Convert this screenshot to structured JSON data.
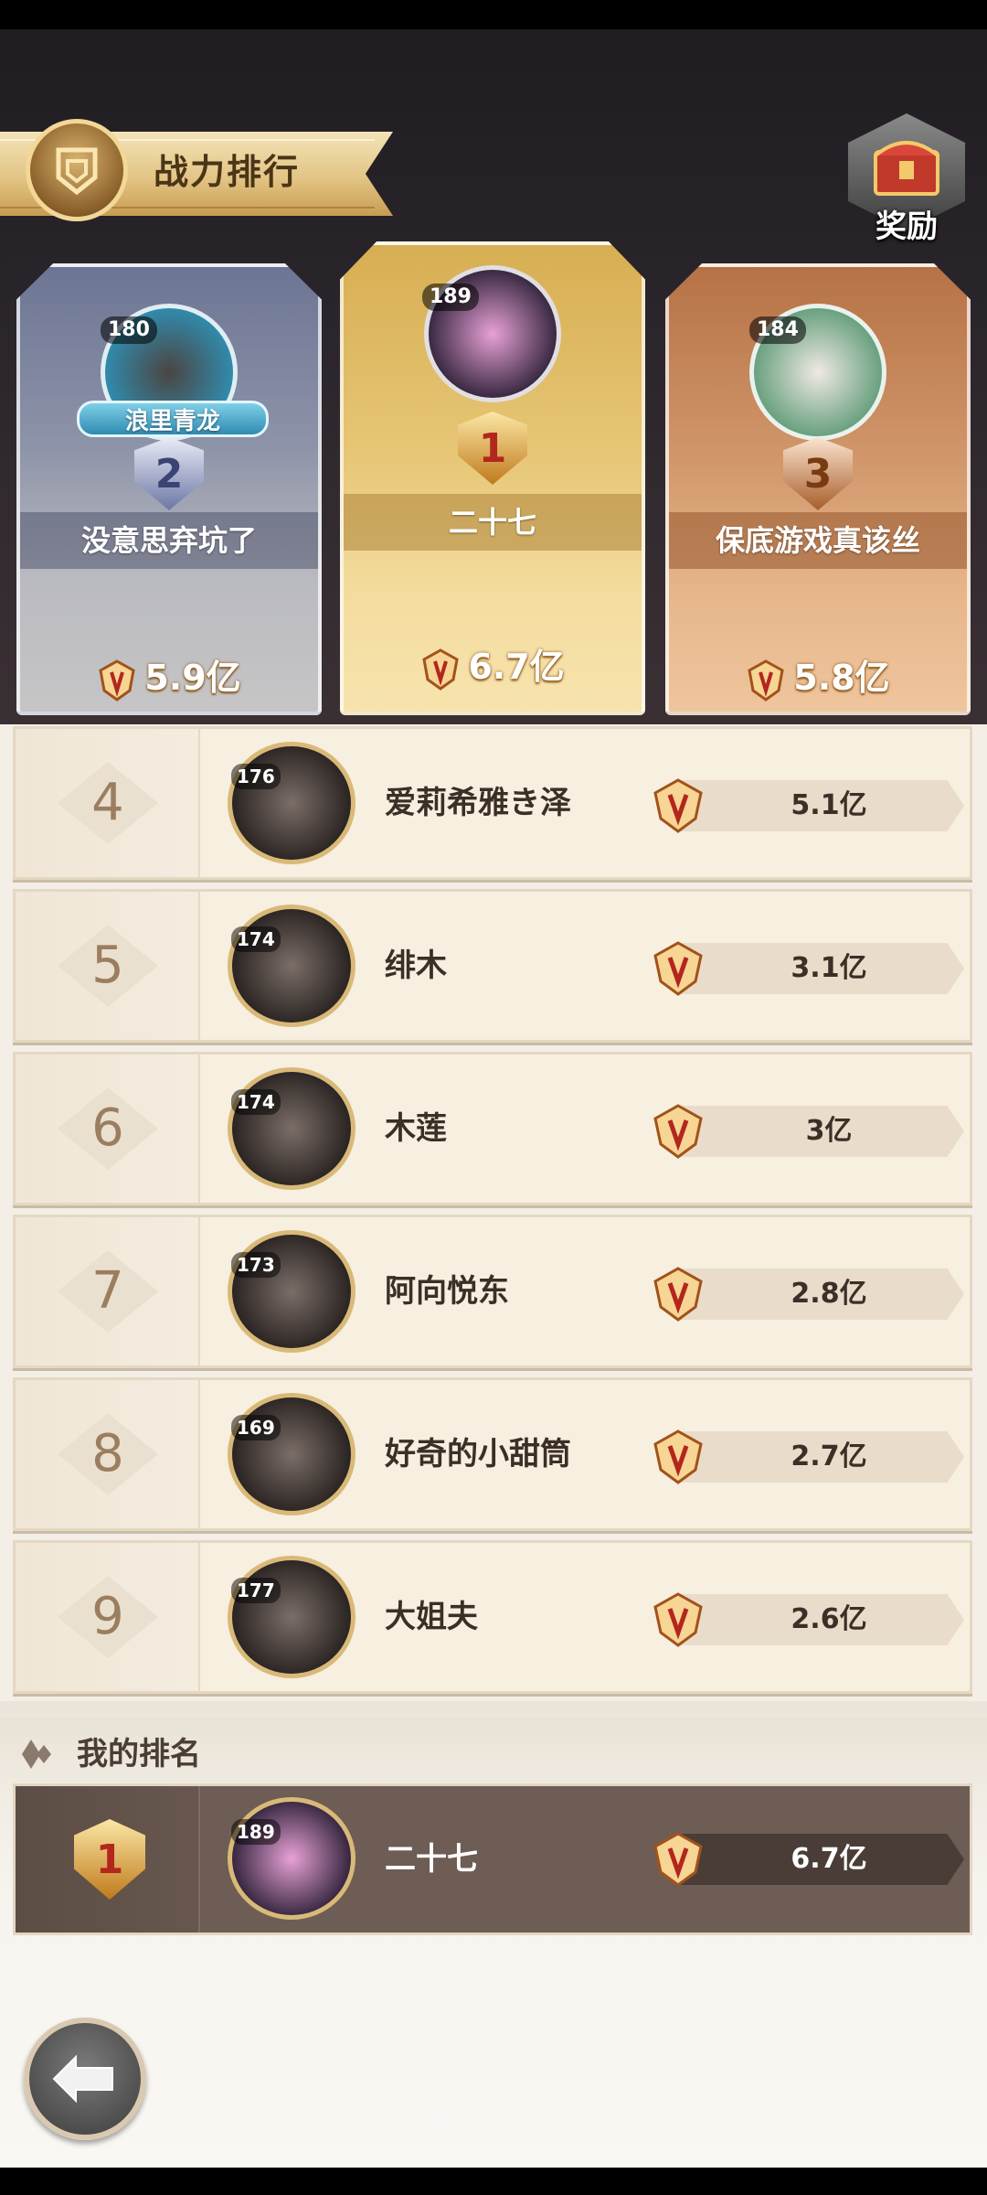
{
  "header": {
    "title": "战力排行",
    "reward_label": "奖励"
  },
  "podium": [
    {
      "rank": "2",
      "level": "180",
      "badge": "浪里青龙",
      "name": "没意思弃坑了",
      "power": "5.9亿"
    },
    {
      "rank": "1",
      "level": "189",
      "name": "二十七",
      "power": "6.7亿"
    },
    {
      "rank": "3",
      "level": "184",
      "name": "保底游戏真该丝",
      "power": "5.8亿"
    }
  ],
  "rows": [
    {
      "rank": "4",
      "level": "176",
      "name": "爱莉希雅き泽",
      "power": "5.1亿"
    },
    {
      "rank": "5",
      "level": "174",
      "name": "绯木",
      "power": "3.1亿"
    },
    {
      "rank": "6",
      "level": "174",
      "name": "木莲",
      "power": "3亿"
    },
    {
      "rank": "7",
      "level": "173",
      "name": "阿向悦东",
      "power": "2.8亿"
    },
    {
      "rank": "8",
      "level": "169",
      "name": "好奇的小甜筒",
      "power": "2.7亿"
    },
    {
      "rank": "9",
      "level": "177",
      "name": "大姐夫",
      "power": "2.6亿"
    }
  ],
  "my_rank": {
    "title": "我的排名",
    "rank": "1",
    "level": "189",
    "name": "二十七",
    "power": "6.7亿"
  },
  "icons": {
    "banner": "shield-emblem-icon",
    "reward": "treasure-chest-icon",
    "power": "power-crest-icon",
    "back": "back-arrow-icon"
  },
  "colors": {
    "gold": "#e3c585",
    "silver": "#8d93a8",
    "bronze": "#cf9468",
    "my_row": "#6d5d54"
  }
}
